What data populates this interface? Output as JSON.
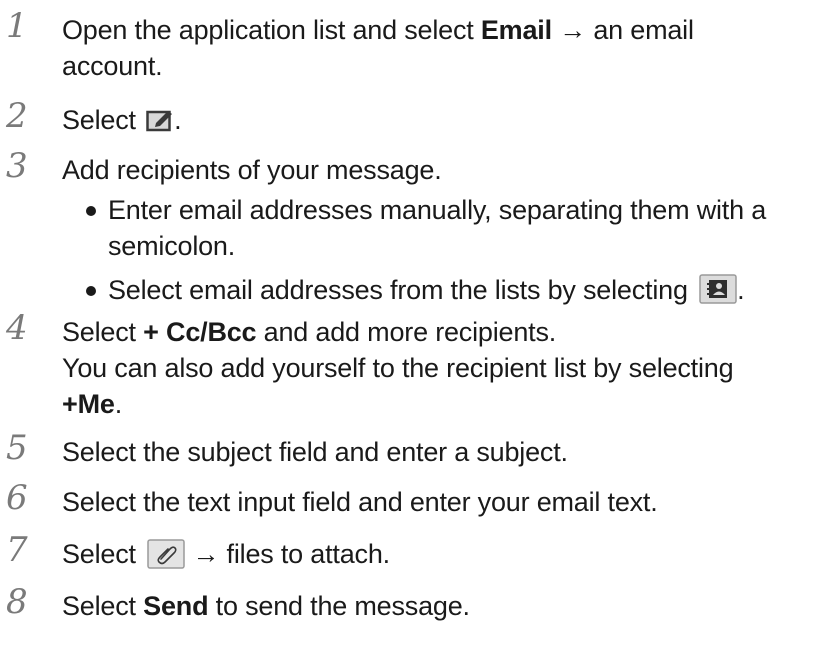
{
  "steps": [
    {
      "number": "1",
      "lines": [
        {
          "pre": "Open the application list and select ",
          "bold": "Email",
          "post": " → an email"
        },
        {
          "pre": "account.",
          "bold": "",
          "post": ""
        }
      ]
    },
    {
      "number": "2",
      "lines": [
        {
          "pre": "Select ",
          "icon": "compose-icon",
          "post": "."
        }
      ]
    },
    {
      "number": "3",
      "lines": [
        {
          "pre": "Add recipients of your message."
        }
      ],
      "bullets": [
        {
          "line1": "Enter email addresses manually, separating them with a",
          "line2": "semicolon."
        },
        {
          "pre": "Select email addresses from the lists by selecting ",
          "icon": "contacts-icon",
          "post": "."
        }
      ]
    },
    {
      "number": "4",
      "lines": [
        {
          "pre": "Select ",
          "bold": "+ Cc/Bcc",
          "post": " and add more recipients."
        },
        {
          "pre": "You can also add yourself to the recipient list by selecting"
        },
        {
          "pre": "",
          "bold": "+Me",
          "post": "."
        }
      ]
    },
    {
      "number": "5",
      "lines": [
        {
          "pre": "Select the subject field and enter a subject."
        }
      ]
    },
    {
      "number": "6",
      "lines": [
        {
          "pre": "Select the text input field and enter your email text."
        }
      ]
    },
    {
      "number": "7",
      "lines": [
        {
          "pre": "Select ",
          "icon": "attach-icon",
          "post": " → files to attach."
        }
      ]
    },
    {
      "number": "8",
      "lines": [
        {
          "pre": "Select ",
          "bold": "Send",
          "post": " to send the message."
        }
      ]
    }
  ],
  "colors": {
    "step_number": "#7a7a7a",
    "text": "#1a1a1a",
    "icon_fill": "#d8d8d8"
  }
}
